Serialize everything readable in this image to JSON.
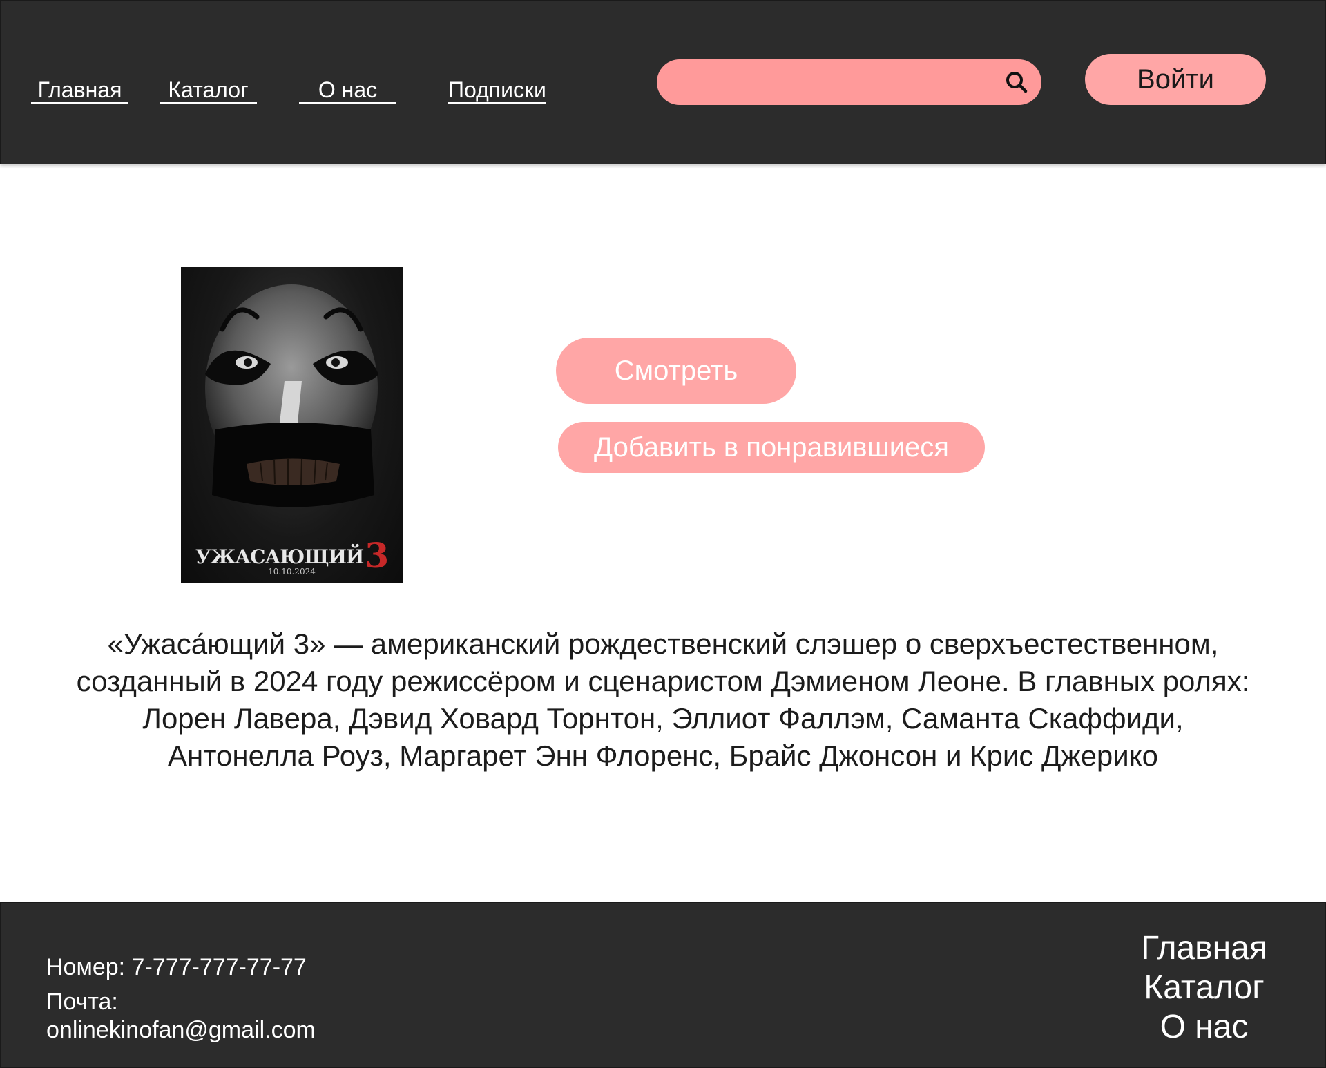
{
  "header": {
    "nav": [
      {
        "label": "Главная"
      },
      {
        "label": "Каталог"
      },
      {
        "label": "О нас"
      },
      {
        "label": "Подписки"
      }
    ],
    "search": {
      "value": "",
      "placeholder": "",
      "icon": "search-icon"
    },
    "login_label": "Войти"
  },
  "movie": {
    "poster": {
      "title": "УЖАСАЮЩИЙ",
      "number": "3",
      "date": "10.10.2024"
    },
    "watch_label": "Смотреть",
    "like_label": "Добавить в понравившиеся",
    "description": "«Ужаса́ющий 3» — американский рождественский слэшер о сверхъестественном, созданный в 2024 году режиссёром и сценаристом Дэмиеном Леоне. В главных ролях: Лорен Лавера, Дэвид Ховард Торнтон, Эллиот Фаллэм, Саманта Скаффиди, Антонелла Роуз, Маргарет Энн Флоренс,  Брайс Джонсон и Крис Джерико"
  },
  "footer": {
    "phone": "Номер: 7-777-777-77-77",
    "mail_label": "Почта:",
    "mail": "onlinekinofan@gmail.com",
    "nav": [
      {
        "label": "Главная"
      },
      {
        "label": "Каталог"
      },
      {
        "label": "О нас"
      }
    ]
  },
  "colors": {
    "header_bg": "#2c2c2c",
    "accent": "#ffa6a6",
    "search_bg": "#ff9a9a",
    "footer_bg": "#2c2c2c"
  }
}
